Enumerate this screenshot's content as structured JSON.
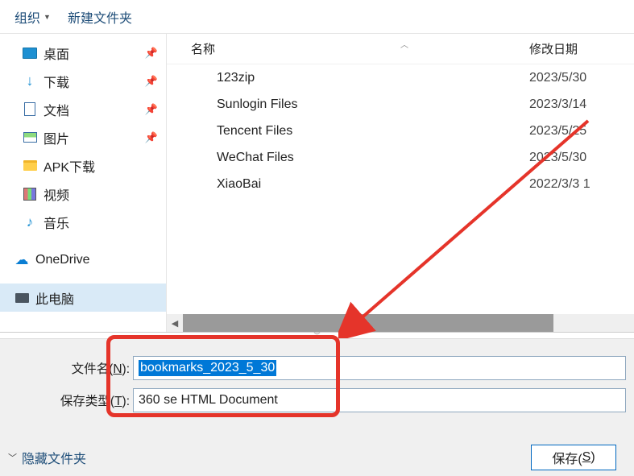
{
  "toolbar": {
    "organize": "组织",
    "new_folder": "新建文件夹"
  },
  "sidebar": {
    "items": [
      {
        "label": "桌面",
        "pinned": true,
        "icon": "desktop"
      },
      {
        "label": "下载",
        "pinned": true,
        "icon": "download"
      },
      {
        "label": "文档",
        "pinned": true,
        "icon": "doc"
      },
      {
        "label": "图片",
        "pinned": true,
        "icon": "pic"
      },
      {
        "label": "APK下载",
        "pinned": false,
        "icon": "folder"
      },
      {
        "label": "视频",
        "pinned": false,
        "icon": "video"
      },
      {
        "label": "音乐",
        "pinned": false,
        "icon": "music"
      },
      {
        "label": "OneDrive",
        "pinned": false,
        "icon": "cloud"
      },
      {
        "label": "此电脑",
        "pinned": false,
        "icon": "pc",
        "selected": true
      }
    ]
  },
  "columns": {
    "name": "名称",
    "date": "修改日期"
  },
  "files": [
    {
      "name": "123zip",
      "date": "2023/5/30"
    },
    {
      "name": "Sunlogin Files",
      "date": "2023/3/14"
    },
    {
      "name": "Tencent Files",
      "date": "2023/5/25"
    },
    {
      "name": "WeChat Files",
      "date": "2023/5/30"
    },
    {
      "name": "XiaoBai",
      "date": "2022/3/3 1"
    }
  ],
  "form": {
    "filename_label_pre": "文件名(",
    "filename_hotkey": "N",
    "filename_label_post": "):",
    "filename_value": "bookmarks_2023_5_30",
    "filetype_label_pre": "保存类型(",
    "filetype_hotkey": "T",
    "filetype_label_post": "):",
    "filetype_value": "360 se HTML Document"
  },
  "bottom": {
    "hide_folders": "隐藏文件夹",
    "save_pre": "保存(",
    "save_hotkey": "S",
    "save_post": ")"
  }
}
